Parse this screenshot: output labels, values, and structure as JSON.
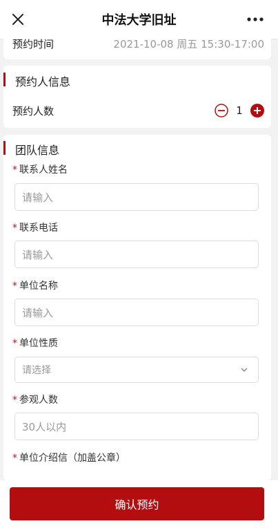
{
  "header": {
    "title": "中法大学旧址"
  },
  "booking_time": {
    "label": "预约时间",
    "value": "2021-10-08 周五 15:30-17:00"
  },
  "booker_info": {
    "section_title": "预约人信息",
    "count_label": "预约人数",
    "count_value": "1"
  },
  "team_info": {
    "section_title": "团队信息",
    "fields": [
      {
        "label": "联系人姓名",
        "placeholder": "请输入"
      },
      {
        "label": "联系电话",
        "placeholder": "请输入"
      },
      {
        "label": "单位名称",
        "placeholder": "请输入"
      },
      {
        "label": "单位性质",
        "placeholder": "请选择"
      },
      {
        "label": "参观人数",
        "placeholder": "30人以内"
      },
      {
        "label": "单位介绍信（加盖公章）"
      }
    ],
    "required_mark": "*"
  },
  "footer": {
    "confirm_label": "确认预约"
  },
  "colors": {
    "accent": "#b30d10",
    "required": "#c0171b"
  },
  "icons": [
    "close-icon",
    "more-icon",
    "minus-circle-icon",
    "plus-circle-icon",
    "chevron-down-icon"
  ]
}
